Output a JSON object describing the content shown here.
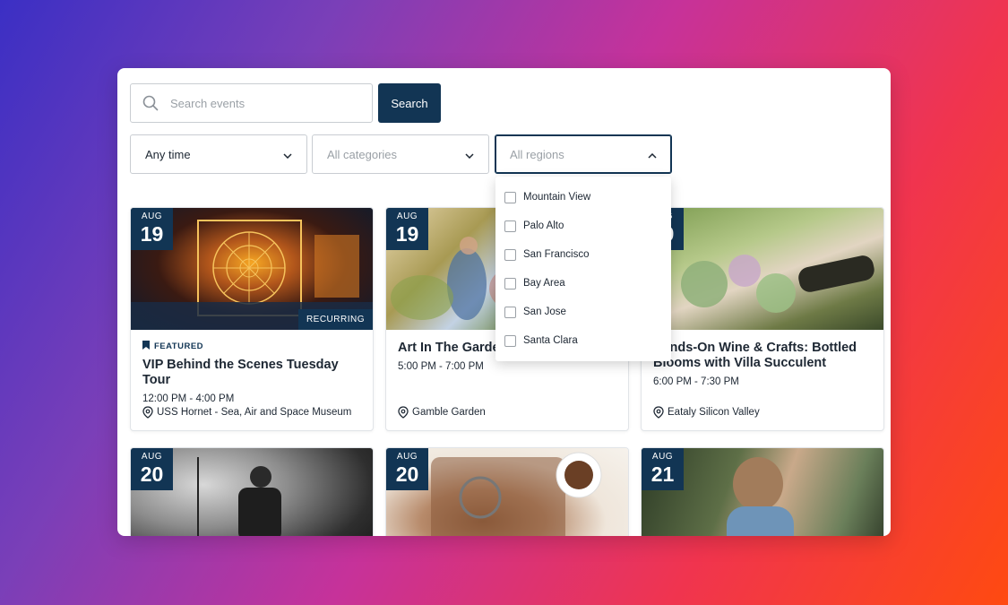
{
  "search": {
    "placeholder": "Search events",
    "button_label": "Search"
  },
  "filters": {
    "time": {
      "value": "Any time"
    },
    "category": {
      "placeholder": "All categories"
    },
    "region": {
      "placeholder": "All regions",
      "options": [
        "Mountain View",
        "Palo Alto",
        "San Francisco",
        "Bay Area",
        "San Jose",
        "Santa Clara"
      ]
    }
  },
  "events": [
    {
      "month": "AUG",
      "day": "19",
      "tag": "RECURRING",
      "featured": "FEATURED",
      "title": "VIP Behind the Scenes Tuesday Tour",
      "time": "12:00 PM - 4:00 PM",
      "location": "USS Hornet - Sea, Air and Space Museum"
    },
    {
      "month": "AUG",
      "day": "19",
      "title": "Art In The Garden",
      "time": "5:00 PM - 7:00 PM",
      "location": "Gamble Garden"
    },
    {
      "month": "AUG",
      "day": "19",
      "title": "Hands-On Wine & Crafts: Bottled Blooms with Villa Succulent",
      "time": "6:00 PM - 7:30 PM",
      "location": "Eataly Silicon Valley"
    },
    {
      "month": "AUG",
      "day": "20"
    },
    {
      "month": "AUG",
      "day": "20"
    },
    {
      "month": "AUG",
      "day": "21"
    }
  ],
  "colors": {
    "accent": "#123554",
    "border": "#c9cdd2"
  }
}
